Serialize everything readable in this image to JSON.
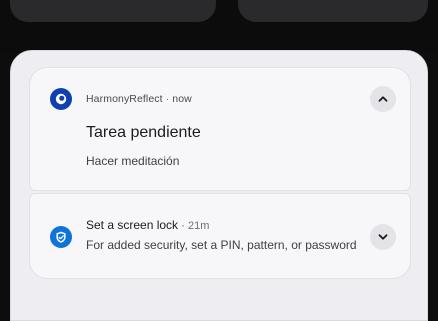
{
  "notifications": [
    {
      "app_name": "HarmonyReflect",
      "time": "now",
      "title": "Tarea pendiente",
      "text": "Hacer meditación",
      "expanded": true
    },
    {
      "title": "Set a screen lock",
      "time": "21m",
      "text": "For added security, set a PIN, pattern, or password",
      "expanded": false
    }
  ],
  "separator": "·",
  "icons": {
    "app_icon_1": "harmonyreflect-app-icon",
    "app_icon_2": "security-shield-icon",
    "collapse": "chevron-up-icon",
    "expand": "chevron-down-icon"
  },
  "colors": {
    "shade_bg": "#eeeef2",
    "card_bg": "#f7f7fa",
    "app_icon_1": "#0f3fb0",
    "app_icon_2": "#0e74d8",
    "button_bg": "#e3e3e8"
  }
}
